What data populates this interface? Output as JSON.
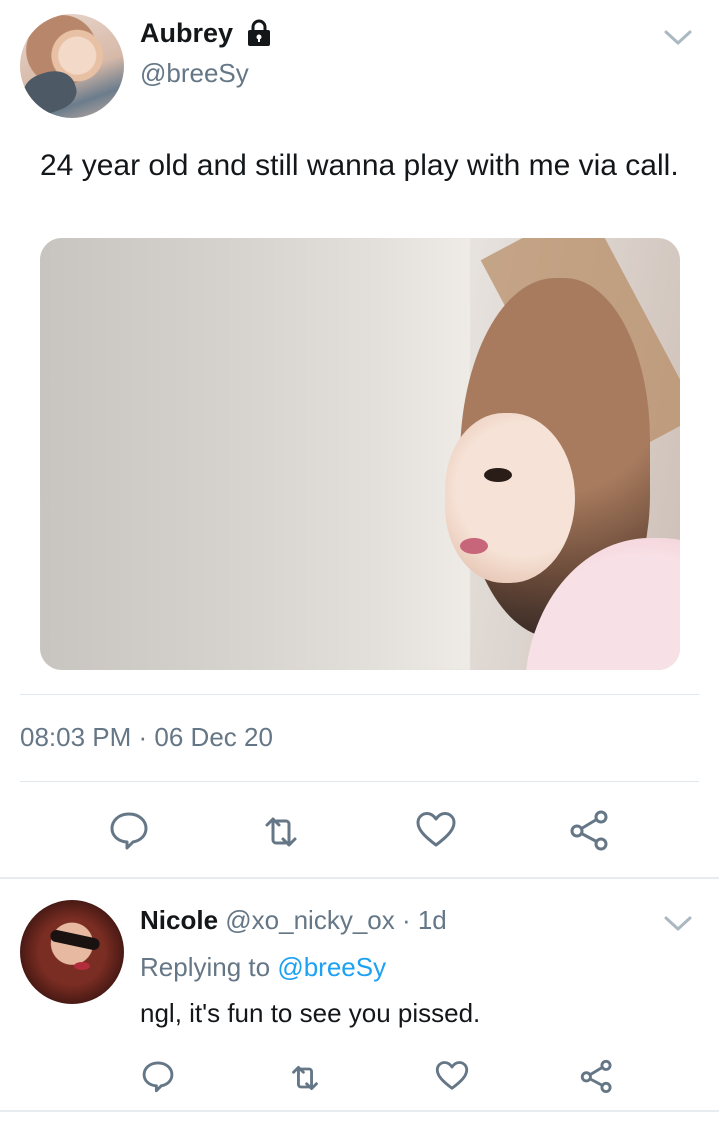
{
  "tweet": {
    "author": {
      "name": "Aubrey",
      "handle": "@breeSy"
    },
    "text": "24 year old and still wanna play with me via call.",
    "timestamp": "08:03 PM · 06 Dec 20"
  },
  "actions": {
    "reply_icon": "speech-bubble-icon",
    "retweet_icon": "retweet-icon",
    "like_icon": "heart-icon",
    "share_icon": "share-icon"
  },
  "reply": {
    "name": "Nicole",
    "meta": "@xo_nicky_ox · 1d",
    "replying_prefix": "Replying to",
    "replying_to": "@breeSy",
    "text": "ngl, it's fun to see you pissed."
  },
  "colors": {
    "text_primary": "#14171a",
    "text_secondary": "#657786",
    "accent": "#1da1f2",
    "icon": "#657786",
    "divider": "#e1e8ed"
  }
}
